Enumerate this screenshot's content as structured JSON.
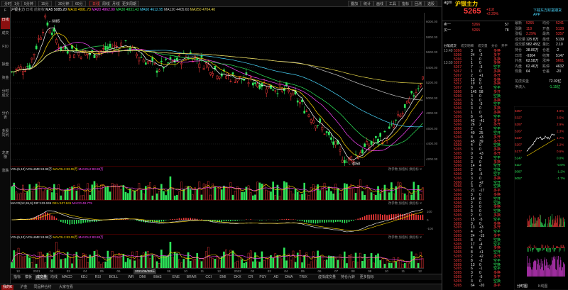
{
  "colors": {
    "up": "#ff3b3b",
    "down": "#2ee65a",
    "ma5": "#ffffff",
    "ma10": "#ffd700",
    "ma20": "#ff44ff",
    "ma30": "#2ee65a",
    "ma60": "#4ad9ff",
    "ma120": "#c8c8c8",
    "ma250": "#e8d84a"
  },
  "toolbar": {
    "items": [
      "分时",
      "1分",
      "5分钟",
      "15分",
      "30分钟",
      "60分",
      "日线",
      "周线",
      "月线",
      "更多周期"
    ],
    "active": "日线",
    "right": [
      "叠加",
      "统计",
      "画线",
      "工具",
      "指标",
      "回测",
      "选股"
    ]
  },
  "leftside": {
    "items": [
      "F",
      "日线",
      "成交",
      "F10",
      "操盘",
      "资金",
      "分时成交",
      "分价表",
      "多股同列",
      "龙虎榜",
      "涨跌"
    ],
    "active": "日线"
  },
  "infobar": {
    "symbol": "沪银主力",
    "mode": "日线",
    "adjust": "前复权",
    "ma5": "MA5 5085.20",
    "ma10": "MA10 4991.73",
    "ma20": "MA20 4962.90",
    "ma30": "MA30 4831.43",
    "ma60": "MA60 4612.95",
    "ma120": "MA120 4405.60",
    "ma250": "MA250 4704.40"
  },
  "main_chart": {
    "y_ticks": [
      "6000.00",
      "5800.00",
      "5600.00",
      "5400.00",
      "5200.00",
      "5000.00",
      "4800.00",
      "4600.00",
      "4400.00",
      "4200.00"
    ],
    "high_label": "6085",
    "low_label": "4058",
    "ymin": 4000,
    "ymax": 6200
  },
  "volume_panel": {
    "title": "VOL(5,10)",
    "vol": "VOLUME:24.98万",
    "mavol1": "MAVOL1:83.08万",
    "mavol2": "MAVOL2:83.88万",
    "tools": [
      "改参数",
      "加指标",
      "换指标",
      "X"
    ]
  },
  "macd_panel": {
    "title": "MACD(12,26,9)",
    "dif": "DIF:133.045",
    "dea": "DEA:107.841",
    "macd": "MACD:48.775",
    "tools": [
      "改参数",
      "加指标",
      "换指标",
      "X"
    ],
    "ticks": [
      "100",
      "0",
      "-100"
    ]
  },
  "vol2_panel": {
    "title": "VOL(5,10)",
    "vol": "VOLUME:24.98万",
    "mavol1": "MAVOL1:83.08万",
    "mavol2": "MAVOL2:83.88万",
    "tools": [
      "改参数",
      "加指标",
      "换指标",
      "X"
    ]
  },
  "x_axis": {
    "labels": [
      "12",
      "2021",
      "02",
      "03",
      "04",
      "05",
      "06",
      "2021/06/30/三",
      "08",
      "09",
      "10",
      "11",
      "12",
      "2022",
      "02",
      "03",
      "04",
      "05",
      "06",
      "07",
      "08",
      "09",
      "10",
      "11",
      "12"
    ]
  },
  "indicator_tabs": [
    "指标",
    "模板",
    "成交量",
    "均线",
    "MACD",
    "KDJ",
    "RSI",
    "BOLL",
    "WR",
    "DMI",
    "BIAS",
    "ENE",
    "BRAR",
    "CCI",
    "DMI",
    "DKX",
    "CR",
    "PSY",
    "AD",
    "DMA",
    "TRIX",
    "虚拟成交量",
    "持仓九转",
    "更多指标"
  ],
  "indicator_active": "成交量",
  "statusbar": {
    "items": [
      "我的K",
      "沪金",
      "同品种合约",
      "大家在看"
    ],
    "active": "我的K"
  },
  "quote": {
    "code": "agm",
    "name": "沪银主力",
    "price": "5265",
    "change": "+118",
    "pct": "+2.29%",
    "menu": "下载东方财富期货APP",
    "ask": {
      "label": "卖一",
      "price": "5266",
      "vol": "57"
    },
    "bid": {
      "label": "买一",
      "price": "5265",
      "vol": "78"
    },
    "stats": [
      [
        "最新",
        "5265",
        "均价",
        "5241"
      ],
      [
        "涨跌",
        "118",
        "开盘",
        "5139"
      ],
      [
        "涨幅",
        "2.29%",
        "最高",
        "5357"
      ],
      [
        "成交量",
        "125.8万",
        "最低",
        "5139"
      ],
      [
        "成交额",
        "982.45亿",
        "量比",
        "2.10"
      ],
      [
        "持仓",
        "38.80万",
        "仓差",
        "-2"
      ],
      [
        "日增",
        "-9304",
        "结算",
        "5147"
      ],
      [
        "外盘",
        "62.58万",
        "涨停",
        "5661"
      ],
      [
        "内盘",
        "62.46万",
        "跌停",
        "4632"
      ],
      [
        "现量",
        "64",
        "仓差",
        "-20"
      ]
    ],
    "dragon": "龙虎资金",
    "dragon_val": "72.02亿",
    "net": "净流入",
    "net_val": "-1.15亿",
    "tabs": [
      "分笔成交",
      "成交明细",
      "成交量",
      "分价",
      "开平"
    ]
  },
  "trades": [
    [
      "13:49",
      "5266",
      "3",
      "0",
      "多换"
    ],
    [
      "",
      "5266",
      "24",
      "-2",
      "多平"
    ],
    [
      "",
      "5266",
      "1",
      "0",
      "多换"
    ],
    [
      "13:50",
      "5267",
      "1",
      "0",
      "多换"
    ],
    [
      "",
      "5267",
      "7",
      "-3",
      "空平"
    ],
    [
      "",
      "5267",
      "1",
      "0",
      "多换"
    ],
    [
      "",
      "5267",
      "2",
      "+1",
      "多开"
    ],
    [
      "",
      "5267",
      "13",
      "0",
      "多换"
    ],
    [
      "",
      "5267",
      "19",
      "0",
      "多换"
    ],
    [
      "",
      "5267",
      "8",
      "-2",
      "空平"
    ],
    [
      "",
      "5266",
      "145",
      "58",
      "多开"
    ],
    [
      "",
      "5266",
      "3",
      "0",
      "空换"
    ],
    [
      "",
      "5266",
      "3",
      "0",
      "多换"
    ],
    [
      "",
      "5266",
      "5",
      "-3",
      "空平"
    ],
    [
      "",
      "5266",
      "3",
      "0",
      "多换"
    ],
    [
      "",
      "5266",
      "1",
      "0",
      "多换"
    ],
    [
      "",
      "5266",
      "8",
      "-6",
      "空平"
    ],
    [
      "",
      "5266",
      "42",
      "-41",
      "多平"
    ],
    [
      "",
      "5266",
      "26",
      "2",
      "多开"
    ],
    [
      "",
      "5266",
      "2",
      "-2",
      "空平"
    ],
    [
      "",
      "5266",
      "40",
      "25",
      "空开"
    ],
    [
      "",
      "5266",
      "8",
      "+3",
      "多开"
    ],
    [
      "",
      "5266",
      "45",
      "39",
      "多开"
    ],
    [
      "",
      "5266",
      "4",
      "0",
      "空换"
    ],
    [
      "",
      "5265",
      "3",
      "0",
      "多换"
    ],
    [
      "",
      "5265",
      "0",
      "+3",
      "多开"
    ],
    [
      "",
      "5266",
      "3",
      "-3",
      "空平"
    ],
    [
      "",
      "5266",
      "3",
      "0",
      "多换"
    ],
    [
      "",
      "5266",
      "14",
      "4",
      "空开"
    ],
    [
      "",
      "5266",
      "2",
      "0",
      "空换"
    ],
    [
      "",
      "5266",
      "9",
      "-5",
      "空平"
    ],
    [
      "",
      "5266",
      "3",
      "0",
      "多换"
    ],
    [
      "",
      "5266",
      "2",
      "+2",
      "空开"
    ],
    [
      "",
      "5266",
      "3",
      "0",
      "空换"
    ],
    [
      "",
      "5266",
      "21",
      "-17",
      "多平"
    ],
    [
      "",
      "5266",
      "3",
      "0",
      "多换"
    ],
    [
      "",
      "5266",
      "14",
      "6",
      "空开"
    ],
    [
      "",
      "5266",
      "2",
      "0",
      "空换"
    ],
    [
      "",
      "5266",
      "3",
      "0",
      "多换"
    ],
    [
      "",
      "5266",
      "5",
      "0",
      "空换"
    ],
    [
      "",
      "5265",
      "2",
      "0",
      "多换"
    ],
    [
      "",
      "5265",
      "15",
      "-5",
      "空平"
    ],
    [
      "",
      "5265",
      "3",
      "0",
      "多换"
    ],
    [
      "",
      "5265",
      "13",
      "+3",
      "多开"
    ],
    [
      "",
      "5265",
      "4",
      "-3",
      "空平"
    ],
    [
      "",
      "5265",
      "24",
      "-15",
      "多平"
    ],
    [
      "",
      "5265",
      "8",
      "0",
      "空换"
    ],
    [
      "",
      "5265",
      "17",
      "-4",
      "空平"
    ],
    [
      "",
      "5265",
      "4",
      "0",
      "多换"
    ],
    [
      "",
      "5265",
      "8",
      "+1",
      "空开"
    ],
    [
      "",
      "5265",
      "2",
      "+2",
      "多开"
    ],
    [
      "",
      "5265",
      "8",
      "-2",
      "空平"
    ],
    [
      "",
      "5265",
      "13",
      "0",
      "空换"
    ],
    [
      "",
      "5265",
      "6",
      "-1",
      "空平"
    ],
    [
      "",
      "5265",
      "3",
      "0",
      "多换"
    ],
    [
      "",
      "5265",
      "7",
      "-5",
      "多平"
    ],
    [
      "",
      "5265",
      "3",
      "0",
      "空换"
    ],
    [
      "",
      "5265",
      "64",
      "-20",
      "多平"
    ]
  ],
  "mini_chart": {
    "labels": [
      "5357",
      "5327",
      "5297",
      "5267",
      "5237",
      "5207",
      "5177",
      "5147",
      "5117",
      "5087",
      "5057"
    ],
    "pct_labels": [
      "4.0%",
      "3.5%",
      "2.9%",
      "2.3%",
      "1.7%",
      "1.2%",
      "0.6%",
      "0.0%",
      "-0.6%",
      "-1.2%",
      "-1.7%"
    ],
    "tabs": [
      "分时",
      "多日"
    ],
    "bottom_tabs": [
      "分时图",
      "K线图"
    ]
  }
}
